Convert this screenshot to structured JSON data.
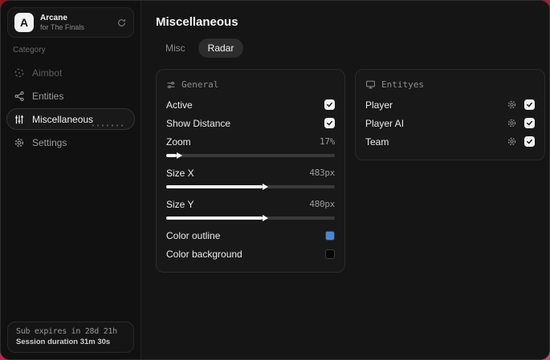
{
  "app": {
    "name": "Arcane",
    "subtitle": "for The Finals",
    "logo_letter": "A"
  },
  "sidebar": {
    "category_label": "Category",
    "items": [
      {
        "label": "Aimbot",
        "icon": "crosshair-icon",
        "selected": false
      },
      {
        "label": "Entities",
        "icon": "share-nodes-icon",
        "selected": false
      },
      {
        "label": "Miscellaneous",
        "icon": "sliders-icon",
        "selected": true
      },
      {
        "label": "Settings",
        "icon": "gear-icon",
        "selected": false
      }
    ],
    "footer": {
      "sub_expires": "Sub expires in 28d 21h",
      "session_duration": "Session duration 31m 30s"
    }
  },
  "main": {
    "title": "Miscellaneous",
    "tabs": [
      {
        "label": "Misc",
        "active": false
      },
      {
        "label": "Radar",
        "active": true
      }
    ],
    "general": {
      "title": "General",
      "active_label": "Active",
      "active_checked": true,
      "show_distance_label": "Show Distance",
      "show_distance_checked": true,
      "zoom_label": "Zoom",
      "zoom_value": "17%",
      "zoom_slider_percent": 6,
      "size_x_label": "Size X",
      "size_x_value": "483px",
      "size_x_slider_percent": 57,
      "size_y_label": "Size Y",
      "size_y_value": "480px",
      "size_y_slider_percent": 57,
      "color_outline_label": "Color outline",
      "color_outline_value": "#4a86d8",
      "color_background_label": "Color background",
      "color_background_value": "#060606"
    },
    "entities": {
      "title": "Entityes",
      "rows": [
        {
          "label": "Player",
          "checked": true
        },
        {
          "label": "Player AI",
          "checked": true
        },
        {
          "label": "Team",
          "checked": true
        }
      ]
    }
  }
}
